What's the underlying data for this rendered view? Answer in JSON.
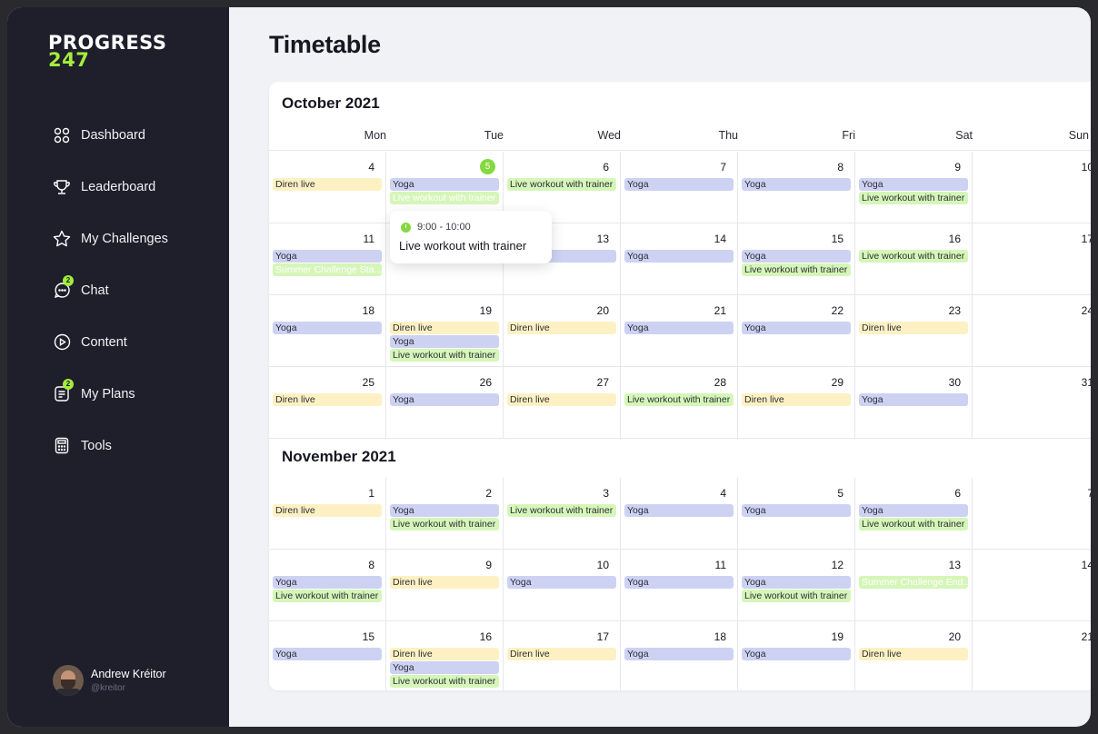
{
  "logo": {
    "line1": "PROGRESS",
    "line2": "247"
  },
  "nav": [
    {
      "label": "Dashboard",
      "icon": "dashboard-icon"
    },
    {
      "label": "Leaderboard",
      "icon": "trophy-icon"
    },
    {
      "label": "My Challenges",
      "icon": "star-icon"
    },
    {
      "label": "Chat",
      "icon": "chat-icon",
      "badge": "2"
    },
    {
      "label": "Content",
      "icon": "play-icon"
    },
    {
      "label": "My Plans",
      "icon": "plans-icon",
      "badge": "2"
    },
    {
      "label": "Tools",
      "icon": "calculator-icon"
    }
  ],
  "user": {
    "name": "Andrew Kréitor",
    "handle": "@kreitor"
  },
  "page_title": "Timetable",
  "weekdays": [
    "Mon",
    "Tue",
    "Wed",
    "Thu",
    "Fri",
    "Sat",
    "Sun"
  ],
  "colors": {
    "accent": "#a4ec3c",
    "yoga": "#cdd2f3",
    "live": "#d5f6b8",
    "diren": "#fdf1c3",
    "sidebar": "#1e1f2b"
  },
  "months": [
    {
      "title": "October 2021",
      "weeks": [
        [
          {
            "day": "4",
            "events": [
              {
                "t": "Diren live",
                "k": "diren"
              }
            ]
          },
          {
            "day": "5",
            "today": true,
            "events": [
              {
                "t": "Yoga",
                "k": "yoga"
              },
              {
                "t": "Live workout with trainer",
                "k": "live faded"
              }
            ]
          },
          {
            "day": "6",
            "events": [
              {
                "t": "Live workout with trainer",
                "k": "live"
              }
            ]
          },
          {
            "day": "7",
            "events": [
              {
                "t": "Yoga",
                "k": "yoga"
              }
            ]
          },
          {
            "day": "8",
            "events": [
              {
                "t": "Yoga",
                "k": "yoga"
              }
            ]
          },
          {
            "day": "9",
            "events": [
              {
                "t": "Yoga",
                "k": "yoga"
              },
              {
                "t": "Live workout with trainer",
                "k": "live"
              }
            ]
          },
          {
            "day": "10",
            "events": []
          }
        ],
        [
          {
            "day": "11",
            "events": [
              {
                "t": "Yoga",
                "k": "yoga"
              },
              {
                "t": "Summer Challenge Sta...",
                "k": "chal"
              }
            ]
          },
          {
            "day": "12",
            "events": []
          },
          {
            "day": "13",
            "events": [
              {
                "t": "Yoga",
                "k": "yoga"
              }
            ]
          },
          {
            "day": "14",
            "events": [
              {
                "t": "Yoga",
                "k": "yoga"
              }
            ]
          },
          {
            "day": "15",
            "events": [
              {
                "t": "Yoga",
                "k": "yoga"
              },
              {
                "t": "Live workout with trainer",
                "k": "live"
              }
            ]
          },
          {
            "day": "16",
            "events": [
              {
                "t": "Live workout with trainer",
                "k": "live"
              }
            ]
          },
          {
            "day": "17",
            "events": []
          }
        ],
        [
          {
            "day": "18",
            "events": [
              {
                "t": "Yoga",
                "k": "yoga"
              }
            ]
          },
          {
            "day": "19",
            "events": [
              {
                "t": "Diren live",
                "k": "diren"
              },
              {
                "t": "Yoga",
                "k": "yoga"
              },
              {
                "t": "Live workout with trainer",
                "k": "live"
              }
            ]
          },
          {
            "day": "20",
            "events": [
              {
                "t": "Diren live",
                "k": "diren"
              }
            ]
          },
          {
            "day": "21",
            "events": [
              {
                "t": "Yoga",
                "k": "yoga"
              }
            ]
          },
          {
            "day": "22",
            "events": [
              {
                "t": "Yoga",
                "k": "yoga"
              }
            ]
          },
          {
            "day": "23",
            "events": [
              {
                "t": "Diren live",
                "k": "diren"
              }
            ]
          },
          {
            "day": "24",
            "events": []
          }
        ],
        [
          {
            "day": "25",
            "events": [
              {
                "t": "Diren live",
                "k": "diren"
              }
            ]
          },
          {
            "day": "26",
            "events": [
              {
                "t": "Yoga",
                "k": "yoga"
              }
            ]
          },
          {
            "day": "27",
            "events": [
              {
                "t": "Diren live",
                "k": "diren"
              }
            ]
          },
          {
            "day": "28",
            "events": [
              {
                "t": "Live workout with trainer",
                "k": "live"
              }
            ]
          },
          {
            "day": "29",
            "events": [
              {
                "t": "Diren live",
                "k": "diren"
              }
            ]
          },
          {
            "day": "30",
            "events": [
              {
                "t": "Yoga",
                "k": "yoga"
              }
            ]
          },
          {
            "day": "31",
            "events": []
          }
        ]
      ]
    },
    {
      "title": "November 2021",
      "weeks": [
        [
          {
            "day": "1",
            "events": [
              {
                "t": "Diren live",
                "k": "diren"
              }
            ]
          },
          {
            "day": "2",
            "events": [
              {
                "t": "Yoga",
                "k": "yoga"
              },
              {
                "t": "Live workout with trainer",
                "k": "live"
              }
            ]
          },
          {
            "day": "3",
            "events": [
              {
                "t": "Live workout with trainer",
                "k": "live"
              }
            ]
          },
          {
            "day": "4",
            "events": [
              {
                "t": "Yoga",
                "k": "yoga"
              }
            ]
          },
          {
            "day": "5",
            "events": [
              {
                "t": "Yoga",
                "k": "yoga"
              }
            ]
          },
          {
            "day": "6",
            "events": [
              {
                "t": "Yoga",
                "k": "yoga"
              },
              {
                "t": "Live workout with trainer",
                "k": "live"
              }
            ]
          },
          {
            "day": "7",
            "events": []
          }
        ],
        [
          {
            "day": "8",
            "events": [
              {
                "t": "Yoga",
                "k": "yoga"
              },
              {
                "t": "Live workout with trainer",
                "k": "live"
              }
            ]
          },
          {
            "day": "9",
            "events": [
              {
                "t": "Diren live",
                "k": "diren"
              }
            ]
          },
          {
            "day": "10",
            "events": [
              {
                "t": "Yoga",
                "k": "yoga"
              }
            ]
          },
          {
            "day": "11",
            "events": [
              {
                "t": "Yoga",
                "k": "yoga"
              }
            ]
          },
          {
            "day": "12",
            "events": [
              {
                "t": "Yoga",
                "k": "yoga"
              },
              {
                "t": "Live workout with trainer",
                "k": "live"
              }
            ]
          },
          {
            "day": "13",
            "events": [
              {
                "t": "Summer Challenge End...",
                "k": "chal"
              }
            ]
          },
          {
            "day": "14",
            "events": []
          }
        ],
        [
          {
            "day": "15",
            "events": [
              {
                "t": "Yoga",
                "k": "yoga"
              }
            ]
          },
          {
            "day": "16",
            "events": [
              {
                "t": "Diren live",
                "k": "diren"
              },
              {
                "t": "Yoga",
                "k": "yoga"
              },
              {
                "t": "Live workout with trainer",
                "k": "live"
              }
            ]
          },
          {
            "day": "17",
            "events": [
              {
                "t": "Diren live",
                "k": "diren"
              }
            ]
          },
          {
            "day": "18",
            "events": [
              {
                "t": "Yoga",
                "k": "yoga"
              }
            ]
          },
          {
            "day": "19",
            "events": [
              {
                "t": "Yoga",
                "k": "yoga"
              }
            ]
          },
          {
            "day": "20",
            "events": [
              {
                "t": "Diren live",
                "k": "diren"
              }
            ]
          },
          {
            "day": "21",
            "events": []
          }
        ]
      ]
    }
  ],
  "tooltip": {
    "time": "9:00 - 10:00",
    "title": "Live workout with trainer"
  }
}
